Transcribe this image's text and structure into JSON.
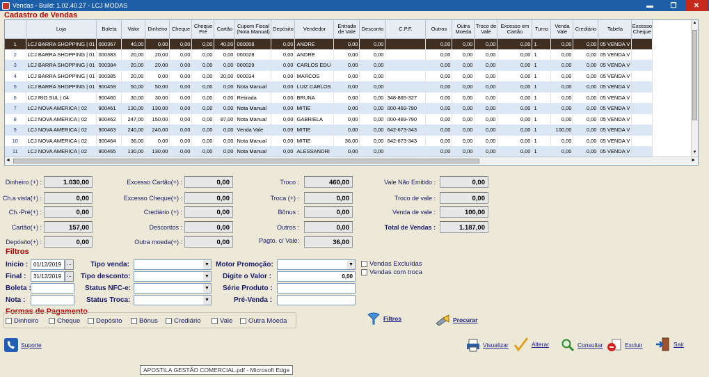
{
  "window": {
    "title": "Vendas - Build: 1.02.40.27 - LCJ MODAS",
    "min": "▬",
    "max": "❐",
    "close": "✕"
  },
  "sections": {
    "cadastro": "Cadastro de Vendas",
    "filtros": "Filtros",
    "formas": "Formas de Pagamento"
  },
  "table": {
    "columns": [
      "",
      "Loja",
      "Boleta",
      "Valor",
      "Dinheiro",
      "Cheque",
      "Cheque Pré",
      "Cartão",
      "Cupom Fiscal (Nota Manual)",
      "Depósito",
      "Vendedor",
      "Entrada de Vale",
      "Desconto",
      "C.P.F.",
      "Outros",
      "Outra Moeda",
      "Troco de Vale",
      "Excesso em Cartão",
      "Turno",
      "Venda Vale",
      "Crediário",
      "Tabela",
      "Excesso Cheque"
    ],
    "rows": [
      [
        "1",
        "LCJ BARRA SHOPPING | 01",
        "000367",
        "40,00",
        "0,00",
        "0,00",
        "0,00",
        "40,00",
        "000008",
        "0,00",
        "ANDRE",
        "0,00",
        "0,00",
        "",
        "0,00",
        "0,00",
        "0,00",
        "0,00",
        "1",
        "0,00",
        "0,00",
        "05 VENDA V",
        ""
      ],
      [
        "2",
        "LCJ BARRA SHOPPING | 01",
        "000383",
        "20,00",
        "20,00",
        "0,00",
        "0,00",
        "0,00",
        "000028",
        "0,00",
        "ANDRE",
        "0,00",
        "0,00",
        "",
        "0,00",
        "0,00",
        "0,00",
        "0,00",
        "1",
        "0,00",
        "0,00",
        "05 VENDA V",
        ""
      ],
      [
        "3",
        "LCJ BARRA SHOPPING | 01",
        "000384",
        "20,00",
        "20,00",
        "0,00",
        "0,00",
        "0,00",
        "000029",
        "0,00",
        "CARLOS EDU",
        "0,00",
        "0,00",
        "",
        "0,00",
        "0,00",
        "0,00",
        "0,00",
        "1",
        "0,00",
        "0,00",
        "05 VENDA V",
        ""
      ],
      [
        "4",
        "LCJ BARRA SHOPPING | 01",
        "000385",
        "20,00",
        "0,00",
        "0,00",
        "0,00",
        "20,00",
        "000034",
        "0,00",
        "MARCOS",
        "0,00",
        "0,00",
        "",
        "0,00",
        "0,00",
        "0,00",
        "0,00",
        "1",
        "0,00",
        "0,00",
        "05 VENDA V",
        ""
      ],
      [
        "5",
        "LCJ BARRA SHOPPING | 01",
        "900459",
        "50,00",
        "50,00",
        "0,00",
        "0,00",
        "0,00",
        "Nota Manual",
        "0,00",
        "LUIZ CARLOS",
        "0,00",
        "0,00",
        "",
        "0,00",
        "0,00",
        "0,00",
        "0,00",
        "1",
        "0,00",
        "0,00",
        "05 VENDA V",
        ""
      ],
      [
        "6",
        "LCJ RIO SUL | 04",
        "900460",
        "30,00",
        "30,00",
        "0,00",
        "0,00",
        "0,00",
        "Retirada",
        "0,00",
        "BRUNA",
        "0,00",
        "0,00",
        "348-865-327",
        "0,00",
        "0,00",
        "0,00",
        "0,00",
        "1",
        "0,00",
        "0,00",
        "05 VENDA V",
        ""
      ],
      [
        "7",
        "LCJ NOVA AMERICA | 02",
        "900461",
        "130,00",
        "130,00",
        "0,00",
        "0,00",
        "0,00",
        "Nota Manual",
        "0,00",
        "MITIE",
        "0,00",
        "0,00",
        "000-469-790",
        "0,00",
        "0,00",
        "0,00",
        "0,00",
        "1",
        "0,00",
        "0,00",
        "05 VENDA V",
        ""
      ],
      [
        "8",
        "LCJ NOVA AMERICA | 02",
        "900462",
        "247,00",
        "150,00",
        "0,00",
        "0,00",
        "97,00",
        "Nota Manual",
        "0,00",
        "GABRIELA",
        "0,00",
        "0,00",
        "000-469-790",
        "0,00",
        "0,00",
        "0,00",
        "0,00",
        "1",
        "0,00",
        "0,00",
        "05 VENDA V",
        ""
      ],
      [
        "9",
        "LCJ NOVA AMERICA | 02",
        "900463",
        "240,00",
        "240,00",
        "0,00",
        "0,00",
        "0,00",
        "Venda Vale",
        "0,00",
        "MITIE",
        "0,00",
        "0,00",
        "642-673-343",
        "0,00",
        "0,00",
        "0,00",
        "0,00",
        "1",
        "100,00",
        "0,00",
        "05 VENDA V",
        ""
      ],
      [
        "10",
        "LCJ NOVA AMERICA | 02",
        "900464",
        "36,00",
        "0,00",
        "0,00",
        "0,00",
        "0,00",
        "Nota Manual",
        "0,00",
        "MITIE",
        "36,00",
        "0,00",
        "642-673-343",
        "0,00",
        "0,00",
        "0,00",
        "0,00",
        "1",
        "0,00",
        "0,00",
        "05 VENDA V",
        ""
      ],
      [
        "11",
        "LCJ NOVA AMERICA | 02",
        "900465",
        "130,00",
        "130,00",
        "0,00",
        "0,00",
        "0,00",
        "Nota Manual",
        "0,00",
        "ALESSANDRI",
        "0,00",
        "0,00",
        "",
        "0,00",
        "0,00",
        "0,00",
        "0,00",
        "1",
        "0,00",
        "0,00",
        "05 VENDA V",
        ""
      ]
    ]
  },
  "totals": {
    "dinheiro": {
      "label": "Dinheiro (+) :",
      "value": "1.030,00"
    },
    "chavista": {
      "label": "Ch.a vista(+) :",
      "value": "0,00"
    },
    "chpre": {
      "label": "Ch.-Pré(+) :",
      "value": "0,00"
    },
    "cartao": {
      "label": "Cartão(+) :",
      "value": "157,00"
    },
    "deposito": {
      "label": "Depósito(+) :",
      "value": "0,00"
    },
    "exc_cartao": {
      "label": "Excesso Cartão(+) :",
      "value": "0,00"
    },
    "exc_cheque": {
      "label": "Excesso Cheque(+) :",
      "value": "0,00"
    },
    "crediario": {
      "label": "Crediário (+) :",
      "value": "0,00"
    },
    "descontos": {
      "label": "Descontos :",
      "value": "0,00"
    },
    "outra_moeda": {
      "label": "Outra moeda(+) :",
      "value": "0,00"
    },
    "troco": {
      "label": "Troco :",
      "value": "460,00"
    },
    "troca": {
      "label": "Troca (+) :",
      "value": "0,00"
    },
    "bonus": {
      "label": "Bônus :",
      "value": "0,00"
    },
    "outros": {
      "label": "Outros :",
      "value": "0,00"
    },
    "pagto_vale": {
      "label": "Pagto. c/ Vale:",
      "value": "36,00"
    },
    "vale_nao_emitido": {
      "label": "Vale Não Emitido :",
      "value": "0,00"
    },
    "troco_vale": {
      "label": "Troco de vale :",
      "value": "0,00"
    },
    "venda_vale": {
      "label": "Venda de vale :",
      "value": "100,00"
    },
    "total_vendas": {
      "label": "Total de Vendas :",
      "value": "1.187,00"
    }
  },
  "filters": {
    "inicio": {
      "label": "Inicio :",
      "value": "01/12/2019"
    },
    "final": {
      "label": "Final :",
      "value": "31/12/2019"
    },
    "boleta": {
      "label": "Boleta :",
      "value": ""
    },
    "nota": {
      "label": "Nota :",
      "value": ""
    },
    "tipo_venda": {
      "label": "Tipo venda:",
      "value": ""
    },
    "tipo_desconto": {
      "label": "Tipo desconto:",
      "value": ""
    },
    "status_nfce": {
      "label": "Status NFC-e:",
      "value": ""
    },
    "status_troca": {
      "label": "Status Troca:",
      "value": ""
    },
    "motor_promocao": {
      "label": "Motor Promoção:",
      "value": ""
    },
    "digite_valor": {
      "label": "Digite o Valor :",
      "value": "0,00"
    },
    "serie_produto": {
      "label": "Série Produto :",
      "value": ""
    },
    "pre_venda": {
      "label": "Pré-Venda :",
      "value": ""
    },
    "date_btn": "...",
    "vendas_excluidas": "Vendas Excluídas",
    "vendas_com_troca": "Vendas com troca"
  },
  "payment_types": [
    "Dinheiro",
    "Cheque",
    "Depósito",
    "Bônus",
    "Crediário",
    "Vale",
    "Outra Moeda"
  ],
  "actions": {
    "filtros": "Filtros",
    "procurar": "Procurar",
    "suporte": "Suporte",
    "visualizar": "Visualizar",
    "alterar": "Alterar",
    "consultar": "Consultar",
    "excluir": "Excluir",
    "sair": "Sair"
  },
  "tooltip": "APOSTILA GESTÃO COMERCIAL.pdf - Microsoft Edge",
  "colors": {
    "section": "#b00000",
    "selected_row": "#3e2f22",
    "alt_row": "#dbe7f5",
    "titlebar": "#1c5ea8"
  }
}
